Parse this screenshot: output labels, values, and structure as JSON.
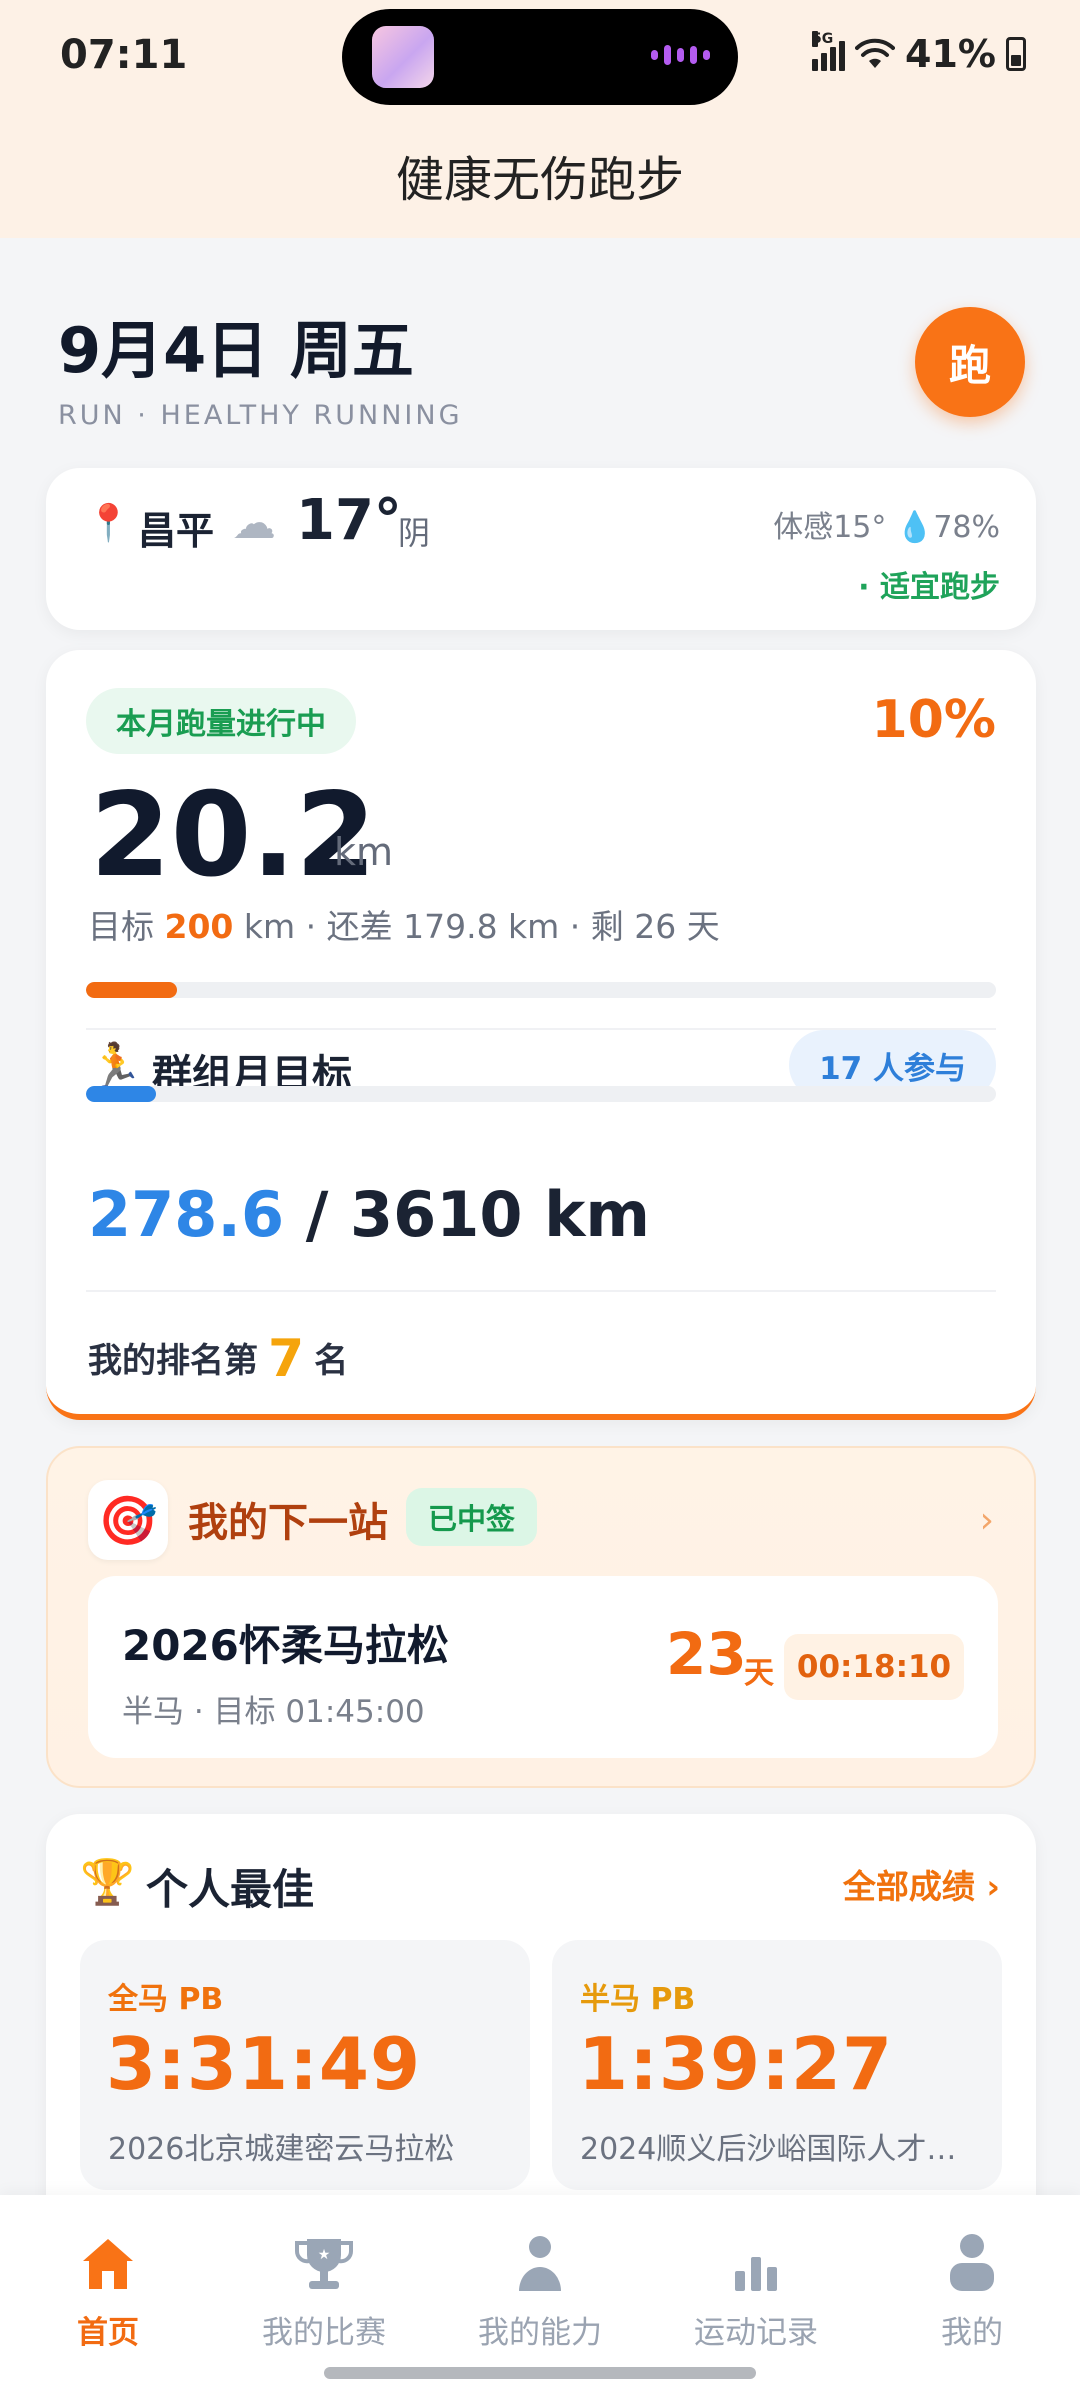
{
  "status_bar": {
    "time": "07:11",
    "network": "5G",
    "battery": "41%"
  },
  "header": {
    "title": "健康无伤跑步"
  },
  "date_section": {
    "date": "9月4日 周五",
    "subtitle": "RUN · HEALTHY RUNNING",
    "run_button": "跑"
  },
  "weather": {
    "city": "昌平",
    "temp": "17°",
    "condition": "阴",
    "feels_like": "体感15°",
    "humidity": "78%",
    "advice": "· 适宜跑步"
  },
  "monthly": {
    "badge": "本月跑量进行中",
    "percent": "10%",
    "progress": 0.1,
    "distance": "20.2",
    "unit": "km",
    "goal_prefix": "目标 ",
    "goal": "200",
    "goal_suffix": " km · 还差 179.8 km · 剩 26 天"
  },
  "group": {
    "title": "群组月目标",
    "participants": "17 人参与",
    "progress": 0.077,
    "current": "278.6",
    "target": " / 3610 km",
    "rank_prefix": "我的排名第",
    "rank": "7",
    "rank_suffix": "名"
  },
  "next_race": {
    "title": "我的下一站",
    "status": "已中签",
    "name": "2026怀柔马拉松",
    "detail": "半马 · 目标 01:45:00",
    "days": "23",
    "days_unit": "天",
    "countdown": "00:18:10"
  },
  "personal_best": {
    "title": "个人最佳",
    "all_link": "全部成绩 ›",
    "items": [
      {
        "label": "全马 PB",
        "time": "3:31:49",
        "race": "2026北京城建密云马拉松"
      },
      {
        "label": "半马 PB",
        "time": "1:39:27",
        "race": "2024顺义后沙峪国际人才…"
      }
    ]
  },
  "nav": {
    "items": [
      {
        "label": "首页",
        "icon": "home-icon"
      },
      {
        "label": "我的比赛",
        "icon": "trophy-icon"
      },
      {
        "label": "我的能力",
        "icon": "person-icon"
      },
      {
        "label": "运动记录",
        "icon": "bar-chart-icon"
      },
      {
        "label": "我的",
        "icon": "profile-icon"
      }
    ],
    "active": 0
  },
  "colors": {
    "accent": "#f97316",
    "green": "#1a9d52",
    "blue": "#2e86e6",
    "gold": "#f5a40c"
  }
}
